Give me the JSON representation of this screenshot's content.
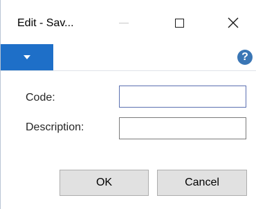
{
  "window": {
    "title": "Edit - Sav..."
  },
  "ribbon": {
    "toggle_icon": "caret-down-icon",
    "help_glyph": "?"
  },
  "form": {
    "code_label": "Code:",
    "code_value": "",
    "description_label": "Description:",
    "description_value": ""
  },
  "buttons": {
    "ok_label": "OK",
    "cancel_label": "Cancel"
  },
  "colors": {
    "ribbon_accent": "#1e6fc8",
    "help_icon": "#3a76b5"
  }
}
